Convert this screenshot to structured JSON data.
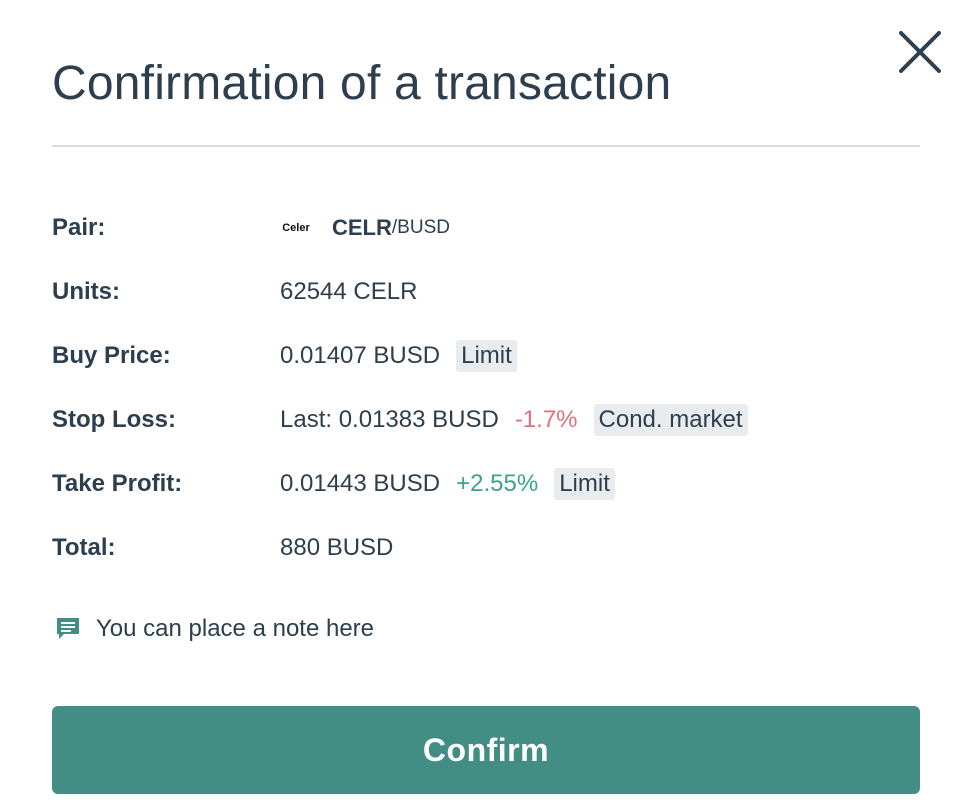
{
  "dialog": {
    "title": "Confirmation of a transaction",
    "close_icon": "close-icon"
  },
  "rows": {
    "pair": {
      "label": "Pair:",
      "logo_text": "Celer",
      "base": "CELR",
      "quote": "/BUSD"
    },
    "units": {
      "label": "Units:",
      "value": "62544 CELR"
    },
    "buy_price": {
      "label": "Buy Price:",
      "value": "0.01407 BUSD",
      "badge": "Limit"
    },
    "stop_loss": {
      "label": "Stop Loss:",
      "value": "Last: 0.01383 BUSD",
      "change": "-1.7%",
      "badge": "Cond. market"
    },
    "take_profit": {
      "label": "Take Profit:",
      "value": "0.01443 BUSD",
      "change": "+2.55%",
      "badge": "Limit"
    },
    "total": {
      "label": "Total:",
      "value": "880 BUSD"
    }
  },
  "note": {
    "icon": "comment-icon",
    "text": "You can place a note here"
  },
  "confirm_button": {
    "label": "Confirm"
  },
  "colors": {
    "text": "#2d3e4e",
    "accent": "#428d84",
    "negative": "#e0707a",
    "positive": "#3aa38a",
    "badge_bg": "#e8ecef",
    "divider": "#d6dee4"
  }
}
